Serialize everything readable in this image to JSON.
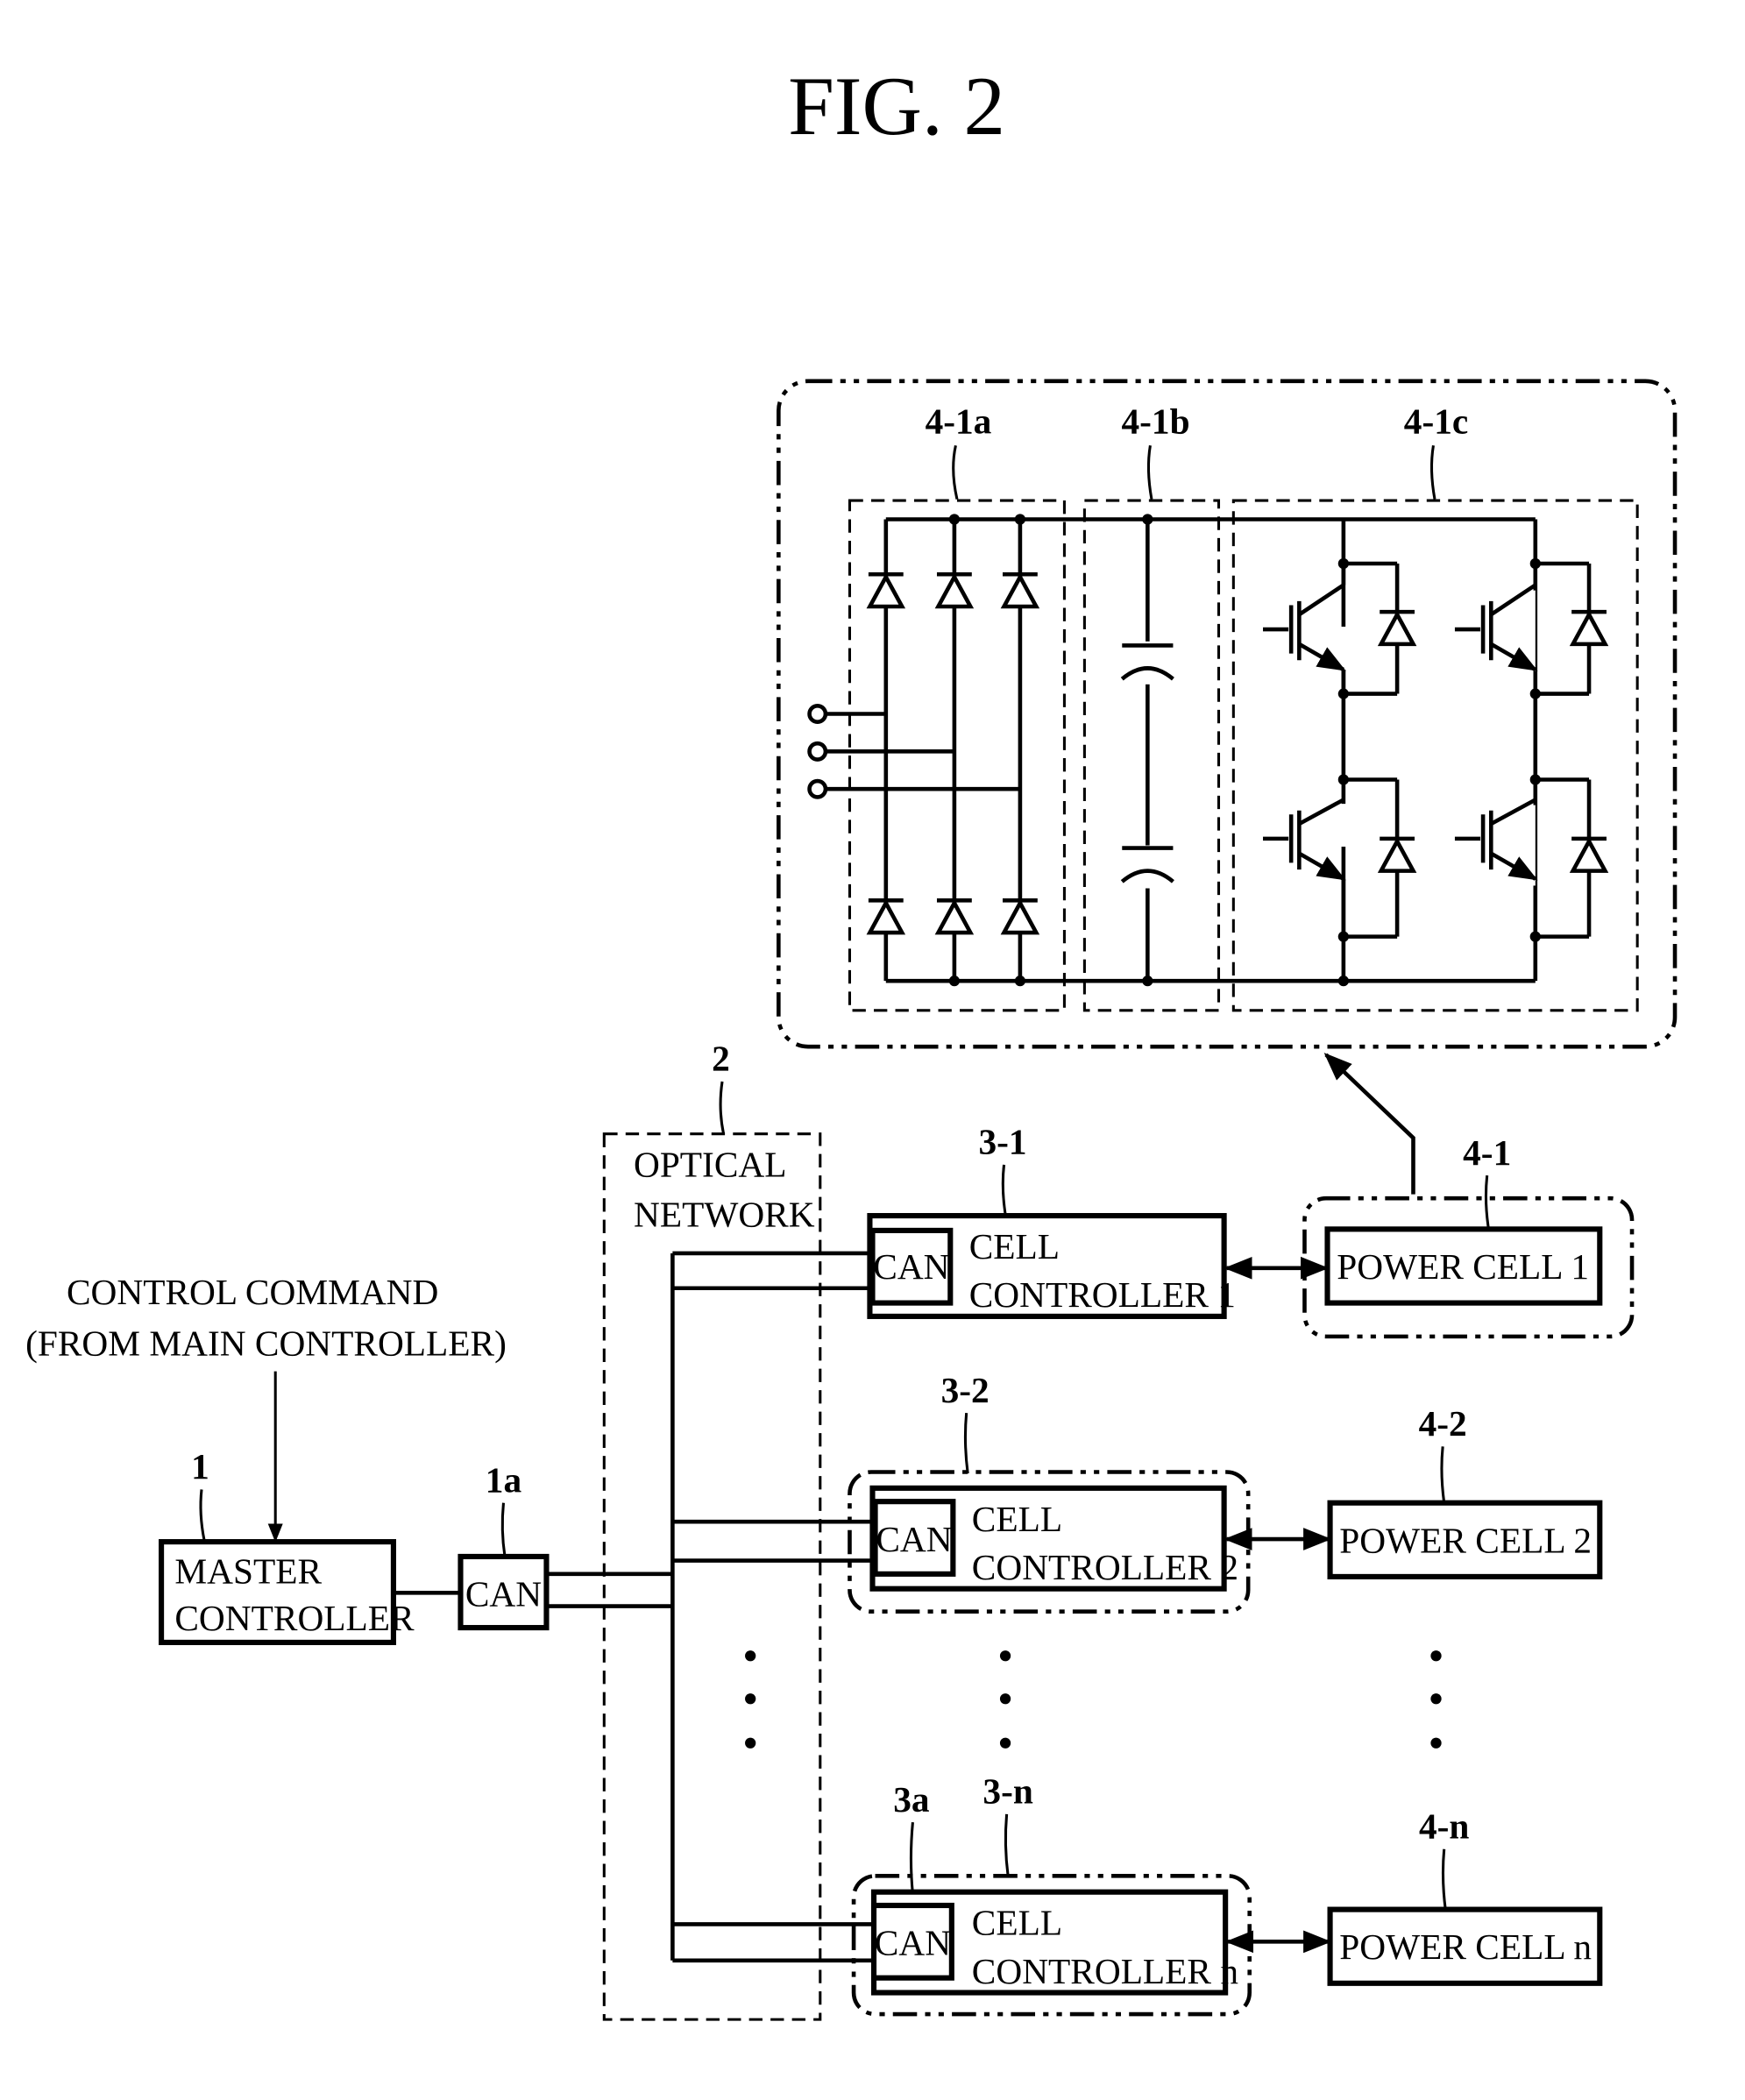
{
  "figure": {
    "title": "FIG.  2"
  },
  "power_cell_detail": {
    "label_rectifier": "4-1a",
    "label_capacitor": "4-1b",
    "label_inverter": "4-1c"
  },
  "network": {
    "ref": "2",
    "line1": "OPTICAL",
    "line2": "NETWORK"
  },
  "command": {
    "line1": "CONTROL COMMAND",
    "line2": "(FROM MAIN CONTROLLER)"
  },
  "master": {
    "ref": "1",
    "line1": "MASTER",
    "line2": "CONTROLLER",
    "can_ref": "1a",
    "can_label": "CAN"
  },
  "cell_controllers": [
    {
      "ref": "3-1",
      "can_label": "CAN",
      "line1": "CELL",
      "line2": "CONTROLLER 1"
    },
    {
      "ref": "3-2",
      "can_label": "CAN",
      "line1": "CELL",
      "line2": "CONTROLLER 2"
    },
    {
      "ref": "3-n",
      "can_ref": "3a",
      "can_label": "CAN",
      "line1": "CELL",
      "line2": "CONTROLLER n"
    }
  ],
  "power_cells": [
    {
      "ref": "4-1",
      "label": "POWER CELL 1"
    },
    {
      "ref": "4-2",
      "label": "POWER CELL 2"
    },
    {
      "ref": "4-n",
      "label": "POWER CELL n"
    }
  ]
}
